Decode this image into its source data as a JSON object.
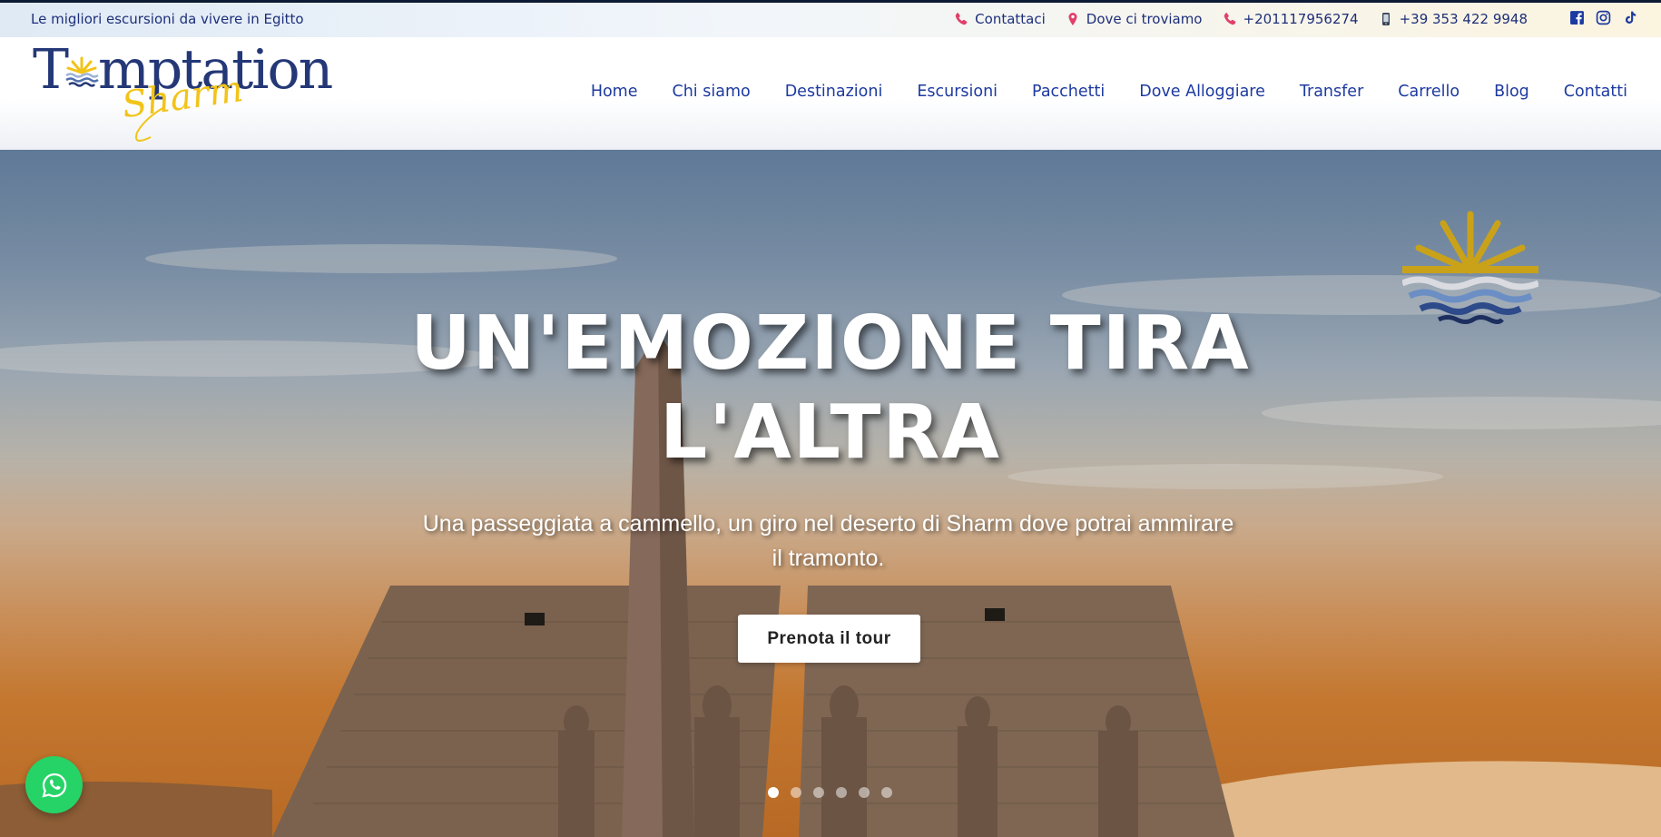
{
  "topbar": {
    "tagline": "Le migliori escursioni da vivere in Egitto",
    "contacts": [
      {
        "label": "Contattaci",
        "icon": "phone-icon"
      },
      {
        "label": "Dove ci troviamo",
        "icon": "map-pin-icon"
      },
      {
        "label": "+201117956274",
        "icon": "phone-icon"
      },
      {
        "label": "+39 353 422 9948",
        "icon": "mobile-phone-icon"
      }
    ],
    "socials": [
      "facebook-icon",
      "instagram-icon",
      "tiktok-icon"
    ]
  },
  "logo": {
    "word_start": "T",
    "word_end": "mptation",
    "script": "Sharm"
  },
  "nav": {
    "items": [
      "Home",
      "Chi siamo",
      "Destinazioni",
      "Escursioni",
      "Pacchetti",
      "Dove Alloggiare",
      "Transfer",
      "Carrello",
      "Blog",
      "Contatti"
    ]
  },
  "hero": {
    "title_line1": "UN'EMOZIONE TIRA",
    "title_line2": "L'ALTRA",
    "subtitle": "Una passeggiata a cammello, un giro nel deserto di Sharm dove potrai ammirare il tramonto.",
    "cta_label": "Prenota il tour",
    "slides_count": 6,
    "active_slide": 1
  },
  "colors": {
    "nav_text": "#1d3aa0",
    "logo_navy": "#243877",
    "logo_gold": "#f2c419",
    "whatsapp": "#26d367",
    "icon_pink": "#e0406a"
  }
}
